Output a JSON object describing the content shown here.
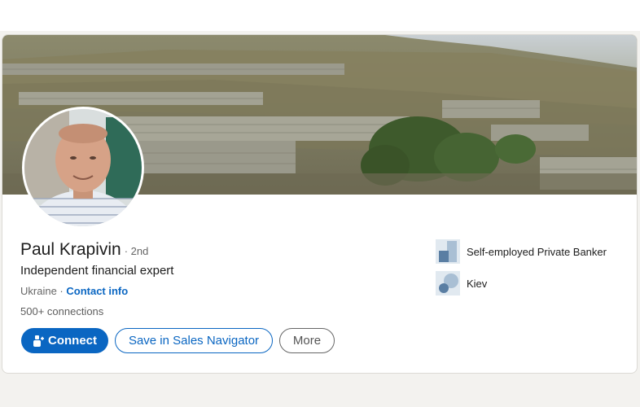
{
  "profile": {
    "name": "Paul Krapivin",
    "degree": "· 2nd",
    "headline": "Independent financial expert",
    "location": "Ukraine · ",
    "contact_info": "Contact info",
    "connections": "500+ connections"
  },
  "actions": {
    "connect": "Connect",
    "sales_navigator": "Save in Sales Navigator",
    "more": "More"
  },
  "experience": {
    "company": "Self-employed Private Banker",
    "company_icon": "building-icon"
  },
  "education": {
    "school": "Kiev",
    "school_icon": "school-icon"
  },
  "colors": {
    "accent": "#0a66c2",
    "page_bg": "#f3f2ef"
  }
}
